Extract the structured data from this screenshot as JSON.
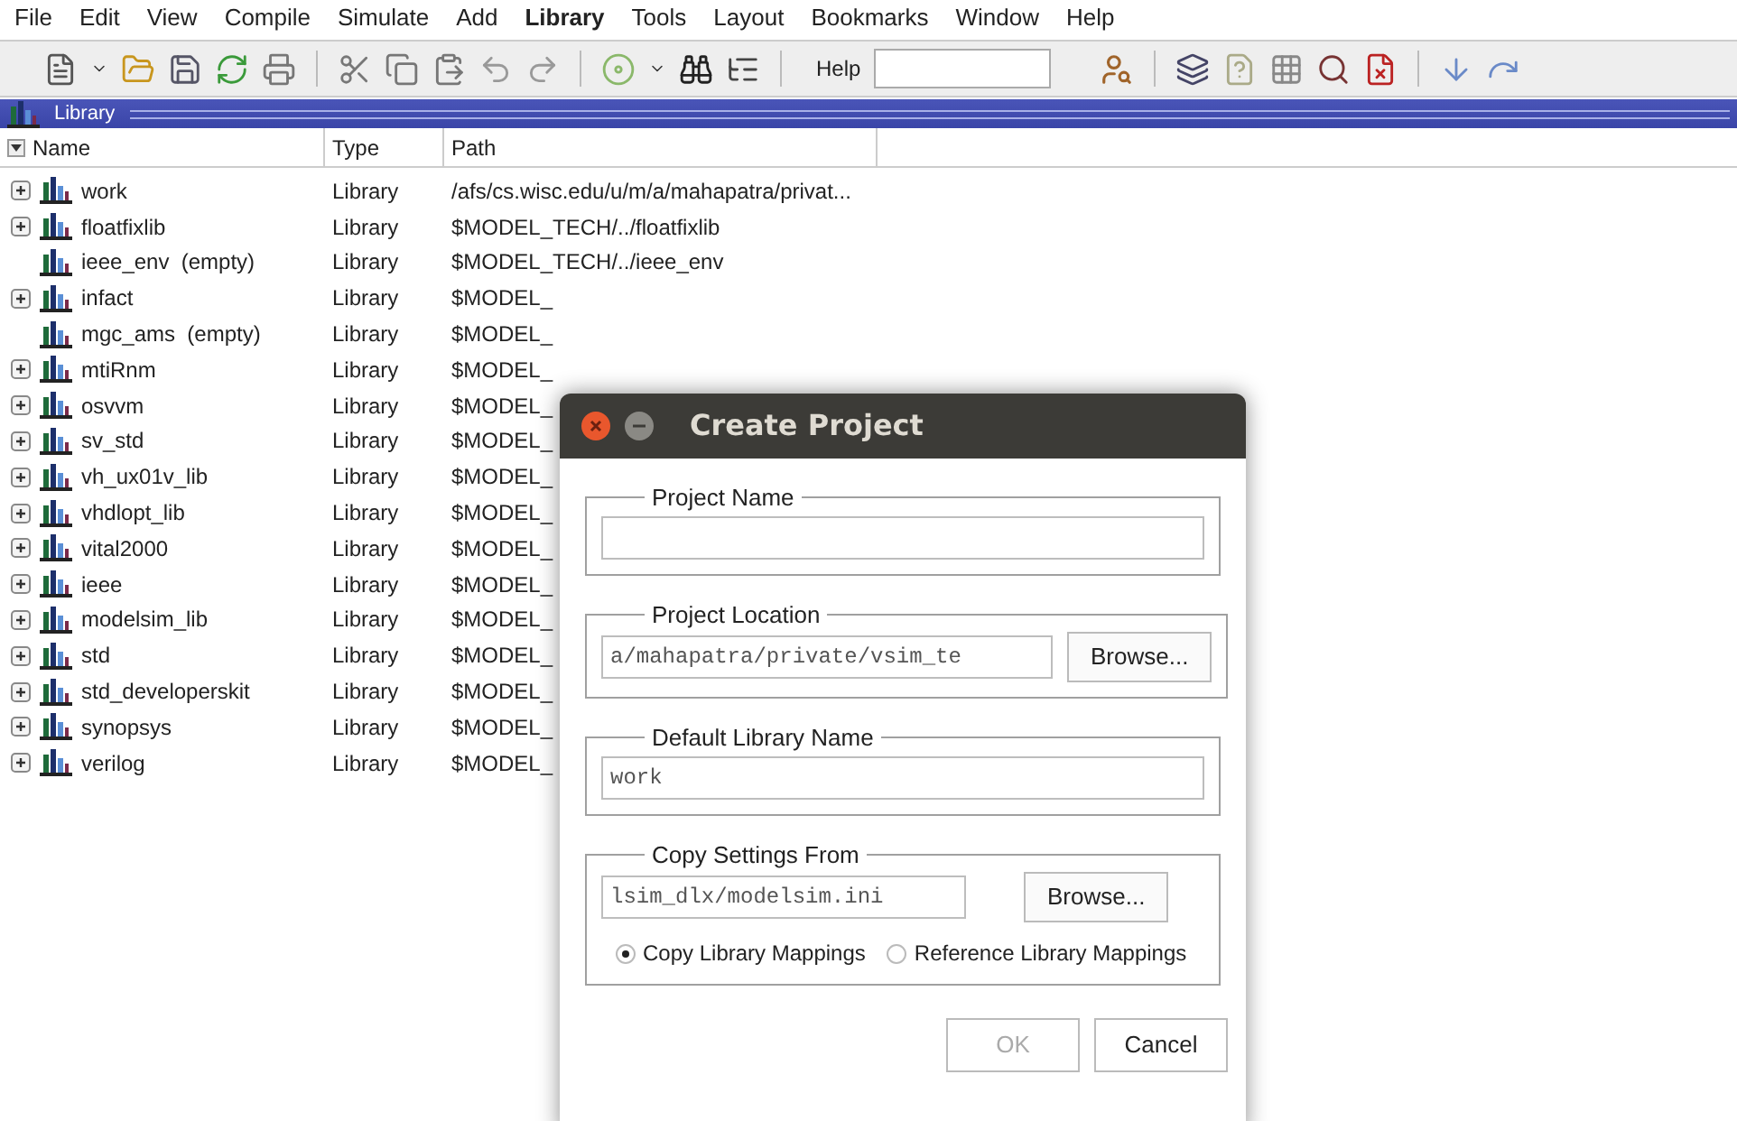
{
  "menu": [
    {
      "label": "File",
      "selected": false
    },
    {
      "label": "Edit",
      "selected": false
    },
    {
      "label": "View",
      "selected": false
    },
    {
      "label": "Compile",
      "selected": false
    },
    {
      "label": "Simulate",
      "selected": false
    },
    {
      "label": "Add",
      "selected": false
    },
    {
      "label": "Library",
      "selected": true
    },
    {
      "label": "Tools",
      "selected": false
    },
    {
      "label": "Layout",
      "selected": false
    },
    {
      "label": "Bookmarks",
      "selected": false
    },
    {
      "label": "Window",
      "selected": false
    },
    {
      "label": "Help",
      "selected": false
    }
  ],
  "toolbar": {
    "help_label": "Help"
  },
  "panel": {
    "title": "Library"
  },
  "table": {
    "columns": [
      "Name",
      "Type",
      "Path"
    ],
    "rows": [
      {
        "name": "work",
        "type": "Library",
        "path": "/afs/cs.wisc.edu/u/m/a/mahapatra/privat...",
        "expandable": true
      },
      {
        "name": "floatfixlib",
        "type": "Library",
        "path": "$MODEL_TECH/../floatfixlib",
        "expandable": true
      },
      {
        "name": "ieee_env  (empty)",
        "type": "Library",
        "path": "$MODEL_TECH/../ieee_env",
        "expandable": false
      },
      {
        "name": "infact",
        "type": "Library",
        "path": "$MODEL_",
        "expandable": true
      },
      {
        "name": "mgc_ams  (empty)",
        "type": "Library",
        "path": "$MODEL_",
        "expandable": false
      },
      {
        "name": "mtiRnm",
        "type": "Library",
        "path": "$MODEL_",
        "expandable": true
      },
      {
        "name": "osvvm",
        "type": "Library",
        "path": "$MODEL_",
        "expandable": true
      },
      {
        "name": "sv_std",
        "type": "Library",
        "path": "$MODEL_",
        "expandable": true
      },
      {
        "name": "vh_ux01v_lib",
        "type": "Library",
        "path": "$MODEL_",
        "expandable": true
      },
      {
        "name": "vhdlopt_lib",
        "type": "Library",
        "path": "$MODEL_",
        "expandable": true
      },
      {
        "name": "vital2000",
        "type": "Library",
        "path": "$MODEL_",
        "expandable": true
      },
      {
        "name": "ieee",
        "type": "Library",
        "path": "$MODEL_",
        "expandable": true
      },
      {
        "name": "modelsim_lib",
        "type": "Library",
        "path": "$MODEL_",
        "expandable": true
      },
      {
        "name": "std",
        "type": "Library",
        "path": "$MODEL_",
        "expandable": true
      },
      {
        "name": "std_developerskit",
        "type": "Library",
        "path": "$MODEL_",
        "expandable": true
      },
      {
        "name": "synopsys",
        "type": "Library",
        "path": "$MODEL_",
        "expandable": true
      },
      {
        "name": "verilog",
        "type": "Library",
        "path": "$MODEL_",
        "expandable": true
      }
    ]
  },
  "dialog": {
    "title": "Create Project",
    "project_name": {
      "label": "Project Name"
    },
    "project_location": {
      "label": "Project Location",
      "value": "a/mahapatra/private/vsim_te",
      "button": "Browse..."
    },
    "default_library": {
      "label": "Default Library Name",
      "value": "work"
    },
    "copy_settings": {
      "label": "Copy Settings From",
      "value": "lsim_dlx/modelsim.ini",
      "button": "Browse...",
      "options": [
        {
          "label": "Copy Library Mappings",
          "selected": true
        },
        {
          "label": "Reference Library Mappings",
          "selected": false
        }
      ]
    },
    "buttons": [
      {
        "label": "OK",
        "disabled": true
      },
      {
        "label": "Cancel",
        "disabled": false
      }
    ]
  }
}
